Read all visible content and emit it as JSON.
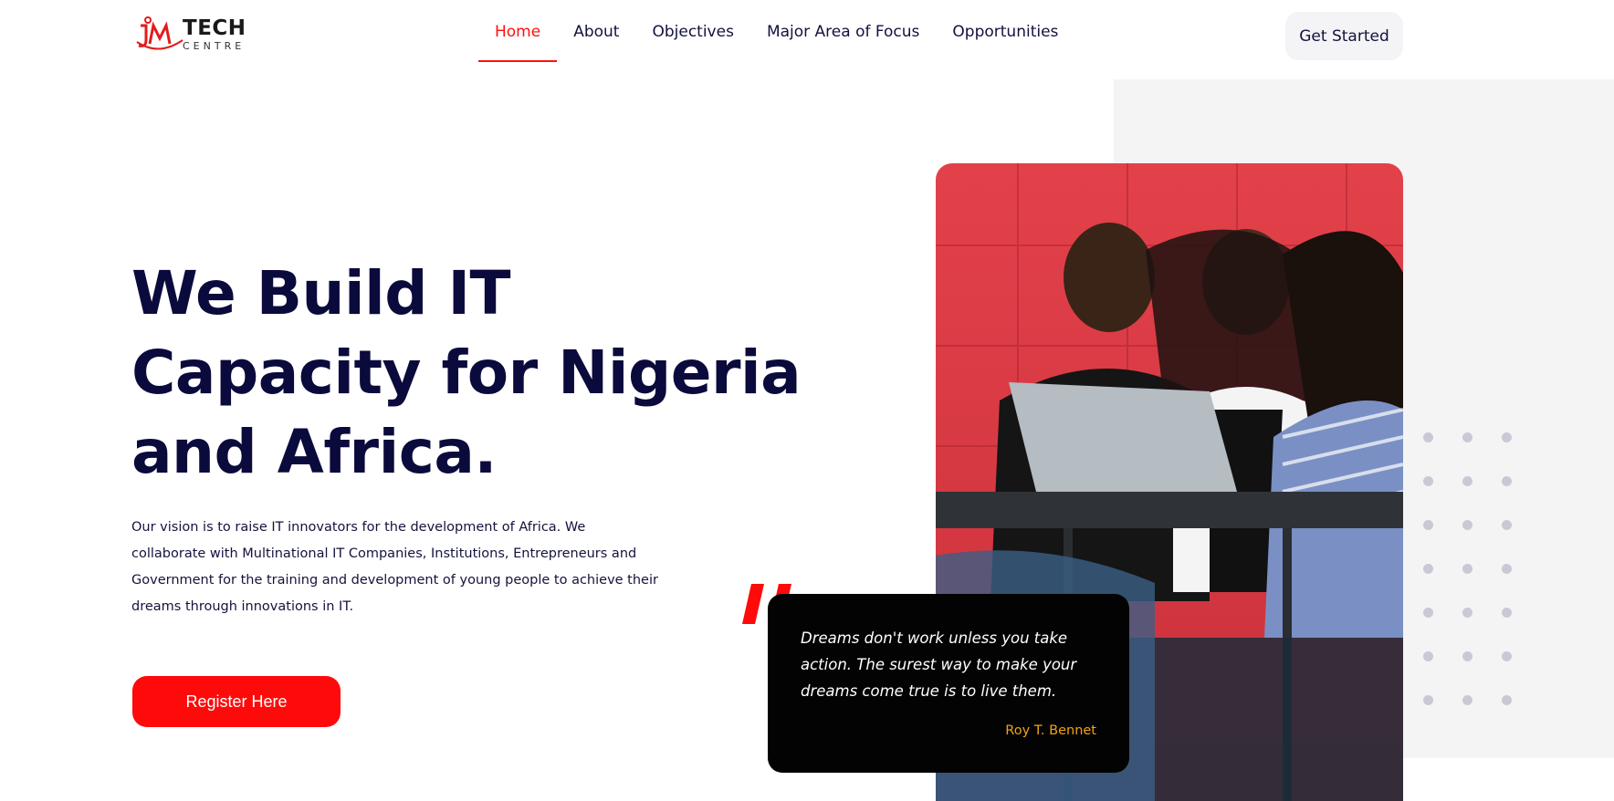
{
  "header": {
    "logo": {
      "mark_icon": "jm-logo-icon",
      "brand": "TECH",
      "sub": "CENTRE"
    },
    "nav": [
      {
        "label": "Home",
        "active": true
      },
      {
        "label": "About",
        "active": false
      },
      {
        "label": "Objectives",
        "active": false
      },
      {
        "label": "Major Area of Focus",
        "active": false
      },
      {
        "label": "Opportunities",
        "active": false
      }
    ],
    "cta_label": "Get Started"
  },
  "hero": {
    "title_lines": [
      "We Build IT",
      "Capacity for Nigeria",
      "and Africa."
    ],
    "description": "Our vision is to raise IT innovators for the development of Africa. We collaborate with Multinational IT Companies, Institutions, Entrepreneurs and Government for the training and development of young people to achieve their dreams through innovations in IT.",
    "register_label": "Register Here"
  },
  "quote": {
    "text": "Dreams don't work unless you take action. The surest way to make your dreams come true is to live them.",
    "author": "Roy T. Bennet"
  },
  "colors": {
    "accent": "#ff0a0a",
    "navy": "#0b0a3c",
    "quote_author": "#f2a40c",
    "panel_bg": "#f4f4f5"
  },
  "icons": {
    "quote_mark": "quote-mark-icon",
    "dots_pattern": "dot-grid-decoration"
  }
}
